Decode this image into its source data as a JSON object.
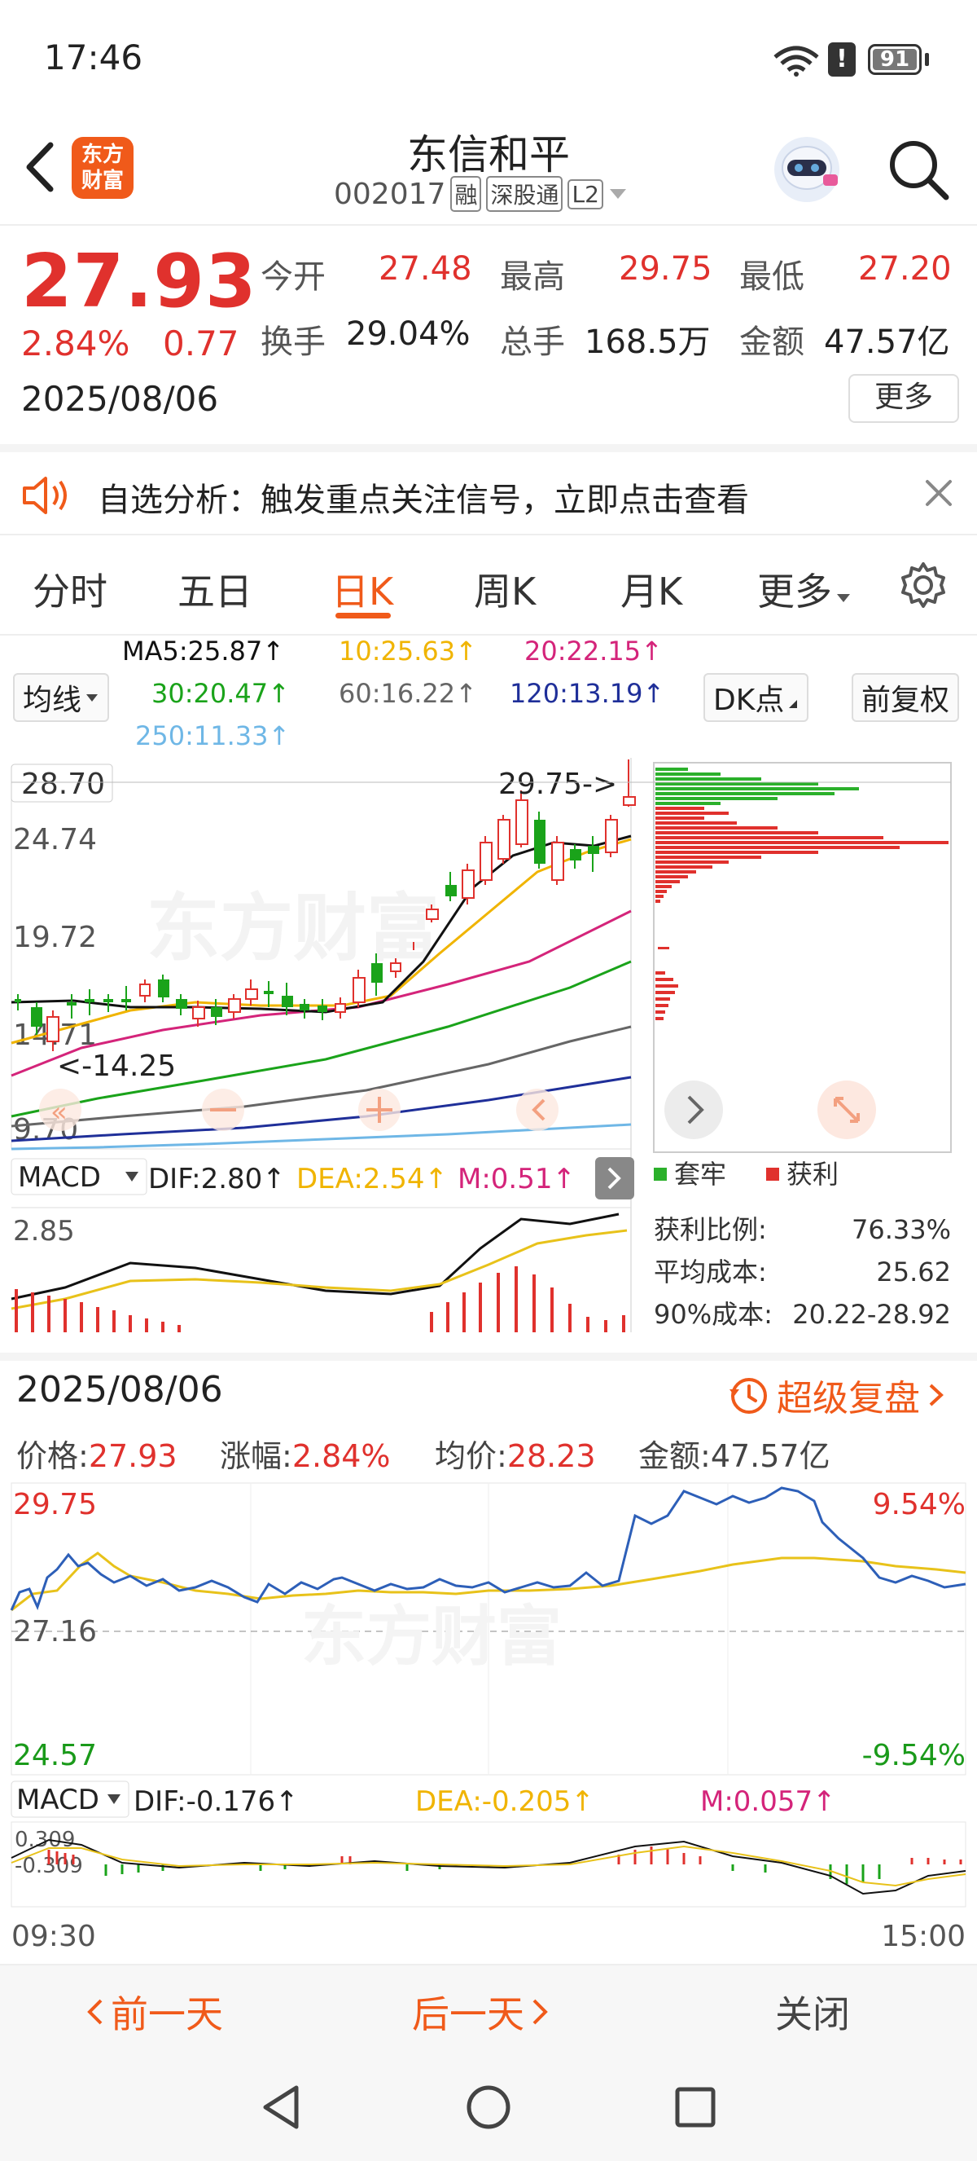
{
  "status_bar": {
    "time": "17:46",
    "battery": "91"
  },
  "header": {
    "title": "东信和平",
    "code": "002017",
    "tags": [
      "融",
      "深股通",
      "L2"
    ],
    "logo_text_1": "东方",
    "logo_text_2": "财富"
  },
  "quote": {
    "price": "27.93",
    "change_pct": "2.84%",
    "change": "0.77",
    "date": "2025/08/06",
    "open_label": "今开",
    "open": "27.48",
    "high_label": "最高",
    "high": "29.75",
    "low_label": "最低",
    "low": "27.20",
    "turnover_label": "换手",
    "turnover": "29.04%",
    "volume_label": "总手",
    "volume": "168.5万",
    "amount_label": "金额",
    "amount": "47.57亿",
    "more_label": "更多"
  },
  "notice": {
    "text": "自选分析：触发重点关注信号，立即点击查看"
  },
  "tabs": [
    {
      "label": "分时"
    },
    {
      "label": "五日"
    },
    {
      "label": "日K"
    },
    {
      "label": "周K"
    },
    {
      "label": "月K"
    },
    {
      "label": "更多"
    }
  ],
  "ma": {
    "selector": "均线",
    "ma5": "MA5:25.87↑",
    "ma10": "10:25.63↑",
    "ma20": "20:22.15↑",
    "ma30": "30:20.47↑",
    "ma60": "60:16.22↑",
    "ma120": "120:13.19↑",
    "ma250": "250:11.33↑",
    "dk_label": "DK点",
    "adjust_label": "前复权",
    "colors": {
      "ma5": "#111111",
      "ma10": "#f0b400",
      "ma20": "#d4247a",
      "ma30": "#1aa31a",
      "ma60": "#666666",
      "ma120": "#1f2f99",
      "ma250": "#6fb7e6"
    }
  },
  "kline": {
    "y_labels": [
      "28.70",
      "24.74",
      "19.72",
      "14.71",
      "9.70"
    ],
    "high_marker": "29.75->",
    "low_marker": "<-14.25"
  },
  "chip_panel": {
    "legend_trapped": "套牢",
    "legend_profit": "获利",
    "profit_ratio_label": "获利比例:",
    "profit_ratio": "76.33%",
    "avg_cost_label": "平均成本:",
    "avg_cost": "25.62",
    "cost90_label": "90%成本:",
    "cost90": "20.22-28.92"
  },
  "macd_k": {
    "label": "MACD",
    "dif": "DIF:2.80↑",
    "dea": "DEA:2.54↑",
    "m": "M:0.51↑",
    "axis": "2.85"
  },
  "detail": {
    "date": "2025/08/06",
    "replay_label": "超级复盘",
    "price_label": "价格:",
    "price": "27.93",
    "chg_label": "涨幅:",
    "chg": "2.84%",
    "avg_label": "均价:",
    "avg": "28.23",
    "amt_label": "金额:",
    "amt": "47.57亿",
    "y_high": "29.75",
    "y_mid": "27.16",
    "y_low": "24.57",
    "pct_high": "9.54%",
    "pct_low": "-9.54%",
    "macd_label": "MACD",
    "dif": "DIF:-0.176↑",
    "dea": "DEA:-0.205↑",
    "m": "M:0.057↑",
    "macd_axis_top": "0.309",
    "macd_axis_bottom": "-0.309",
    "time_start": "09:30",
    "time_end": "15:00"
  },
  "bottom": {
    "prev": "前一天",
    "next": "后一天",
    "close": "关闭"
  },
  "watermark": "东方财富"
}
